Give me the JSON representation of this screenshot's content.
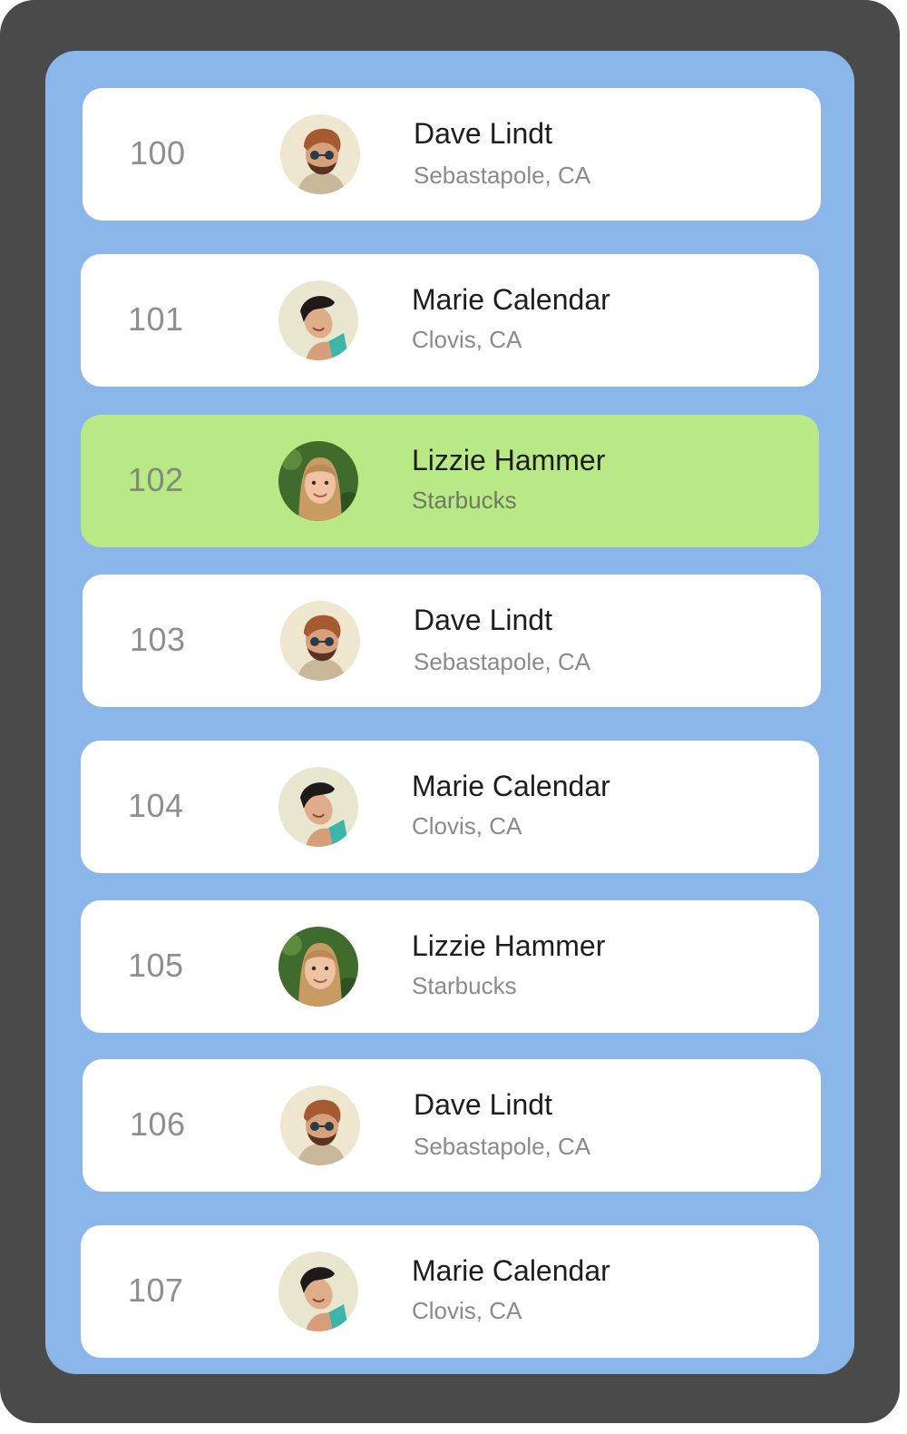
{
  "list": {
    "rows": [
      {
        "number": "100",
        "name": "Dave Lindt",
        "subtitle": "Sebastapole, CA",
        "avatar": "avatar-dave",
        "selected": false
      },
      {
        "number": "101",
        "name": "Marie Calendar",
        "subtitle": "Clovis, CA",
        "avatar": "avatar-marie",
        "selected": false
      },
      {
        "number": "102",
        "name": "Lizzie Hammer",
        "subtitle": "Starbucks",
        "avatar": "avatar-lizzie",
        "selected": true
      },
      {
        "number": "103",
        "name": "Dave Lindt",
        "subtitle": "Sebastapole, CA",
        "avatar": "avatar-dave",
        "selected": false
      },
      {
        "number": "104",
        "name": "Marie Calendar",
        "subtitle": "Clovis, CA",
        "avatar": "avatar-marie",
        "selected": false
      },
      {
        "number": "105",
        "name": "Lizzie Hammer",
        "subtitle": "Starbucks",
        "avatar": "avatar-lizzie",
        "selected": false
      },
      {
        "number": "106",
        "name": "Dave Lindt",
        "subtitle": "Sebastapole, CA",
        "avatar": "avatar-dave",
        "selected": false
      },
      {
        "number": "107",
        "name": "Marie Calendar",
        "subtitle": "Clovis, CA",
        "avatar": "avatar-marie",
        "selected": false
      }
    ]
  },
  "colors": {
    "frame": "#4a4a4a",
    "background": "#8ab6e9",
    "row": "#ffffff",
    "row_selected": "#b9e887",
    "number_text": "#8e8e8e",
    "name_text": "#1d1d1d",
    "subtitle_text": "#8a8a8a"
  }
}
